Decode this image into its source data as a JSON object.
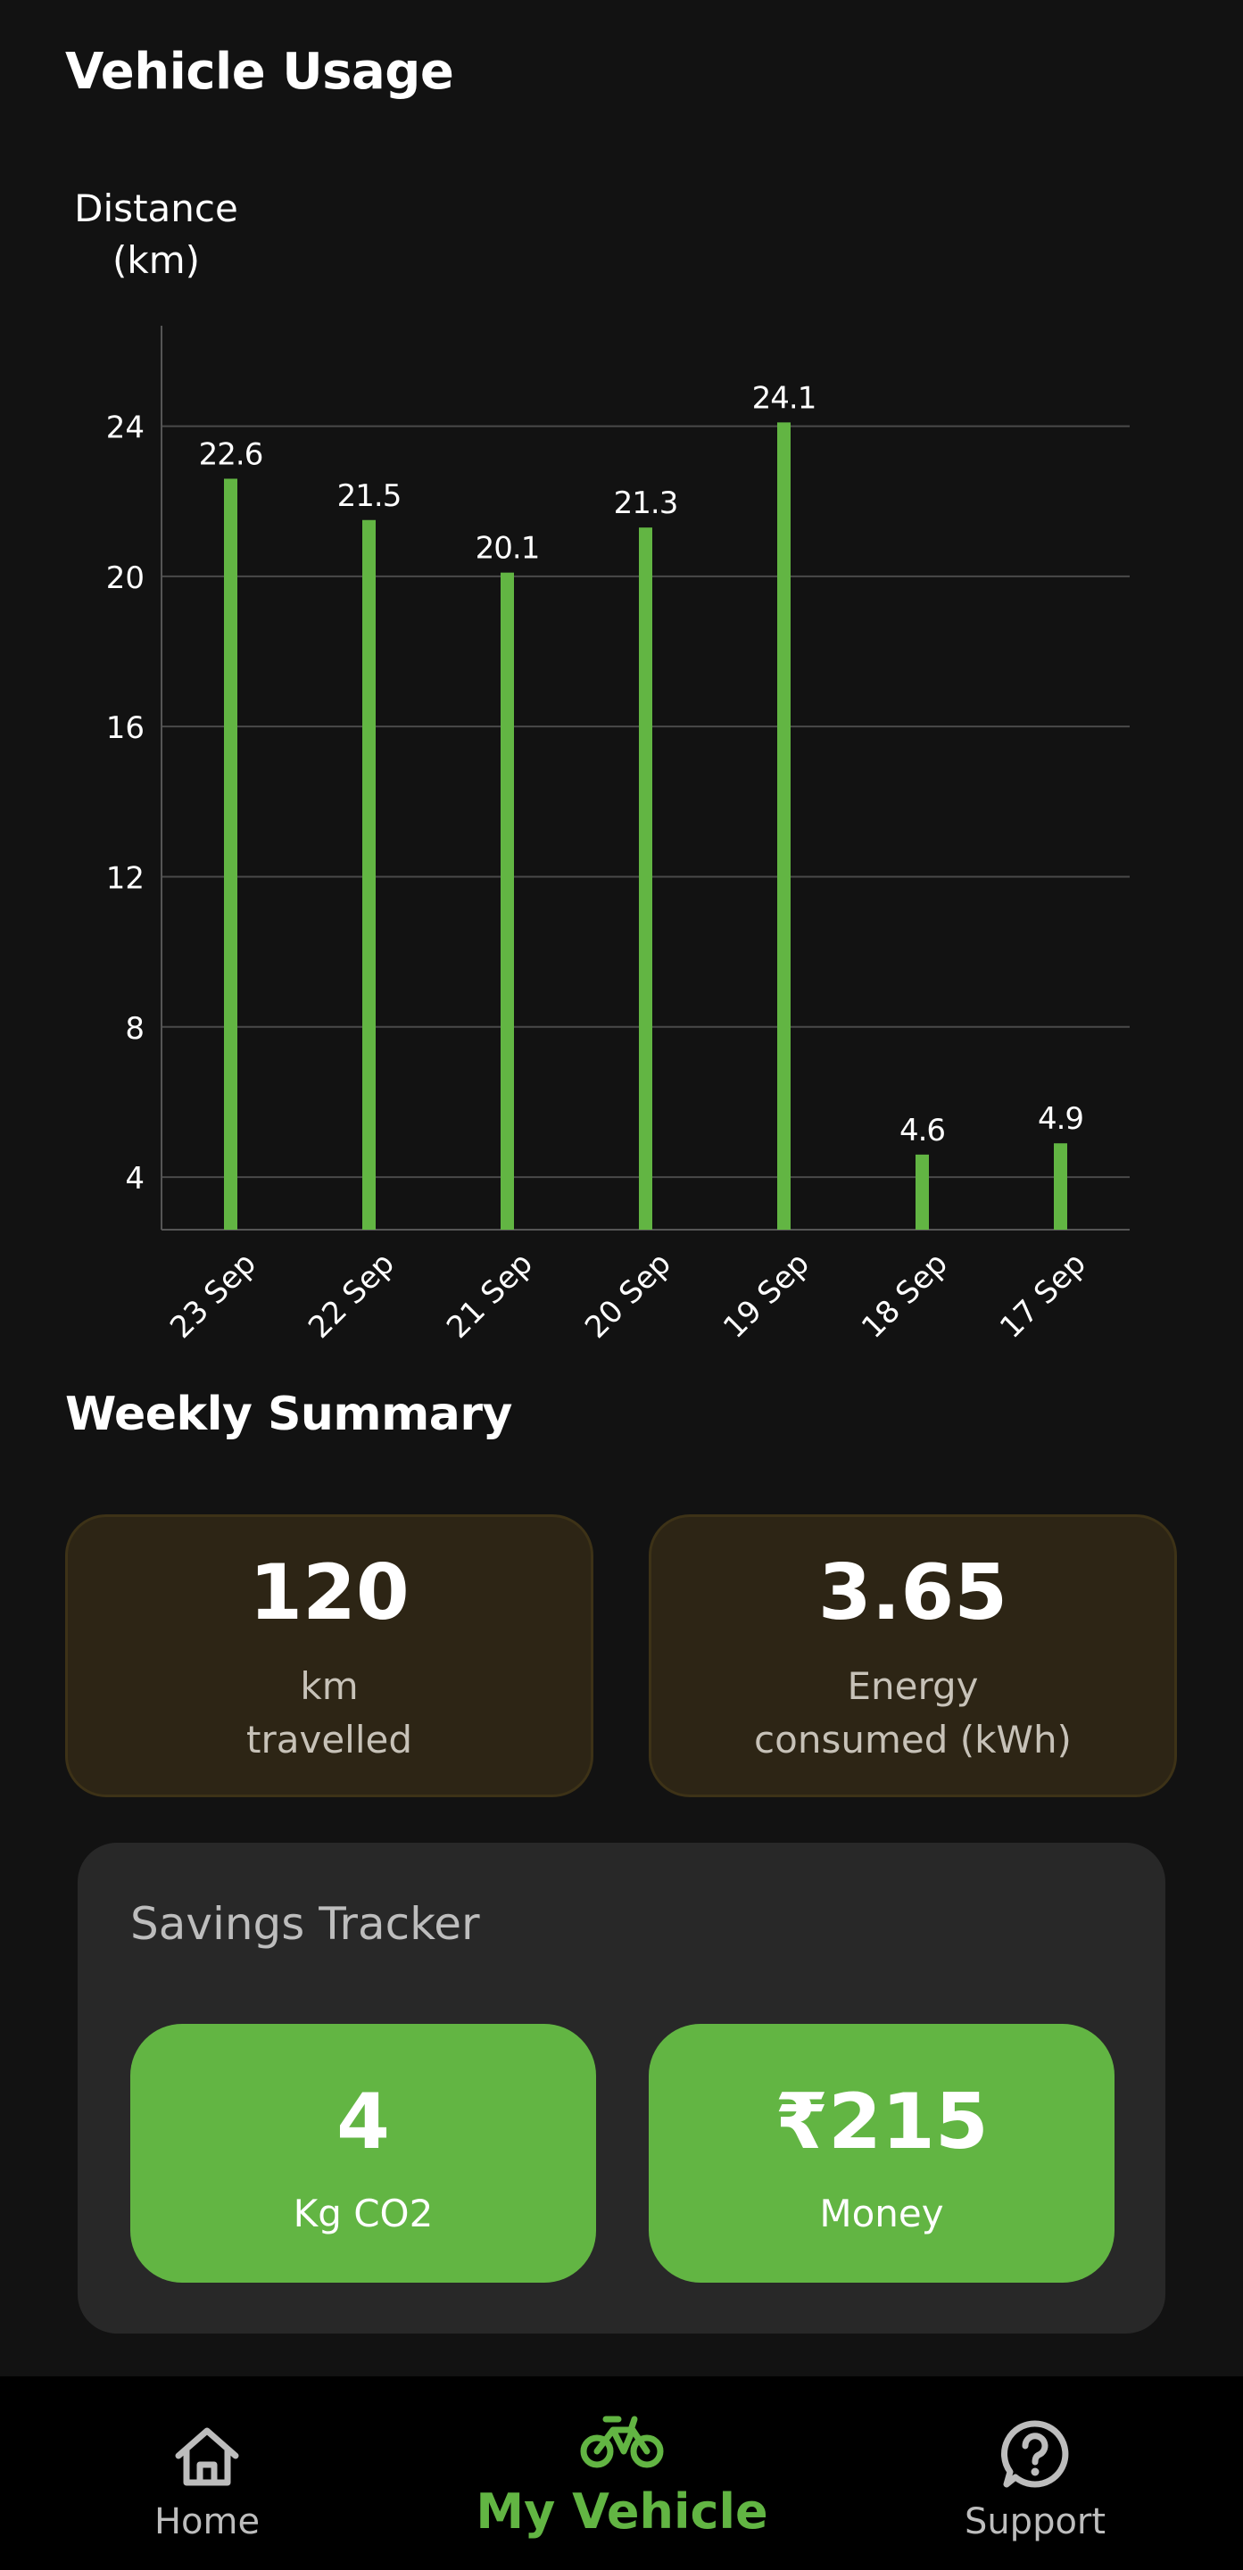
{
  "page": {
    "title": "Vehicle Usage"
  },
  "chart_data": {
    "type": "bar",
    "ylabel": "Distance\n(km)",
    "ylabel_lines": [
      "Distance",
      "(km)"
    ],
    "categories": [
      "23 Sep",
      "22 Sep",
      "21 Sep",
      "20 Sep",
      "19 Sep",
      "18 Sep",
      "17 Sep"
    ],
    "values": [
      22.6,
      21.5,
      20.1,
      21.3,
      24.1,
      4.6,
      4.9
    ],
    "value_labels": [
      "22.6",
      "21.5",
      "20.1",
      "21.3",
      "24.1",
      "4.6",
      "4.9"
    ],
    "yticks": [
      4,
      8,
      12,
      16,
      20,
      24
    ],
    "ylim": [
      2.6,
      26.2
    ],
    "grid": true,
    "bar_color": "#62b543"
  },
  "weekly_summary": {
    "title": "Weekly Summary",
    "distance": {
      "value": "120",
      "label_line1": "km",
      "label_line2": "travelled"
    },
    "energy": {
      "value": "3.65",
      "label_line1": "Energy",
      "label_line2": "consumed (kWh)"
    }
  },
  "savings": {
    "title": "Savings Tracker",
    "co2": {
      "value": "4",
      "label": "Kg CO2"
    },
    "money": {
      "value": "₹215",
      "label": "Money"
    }
  },
  "nav": {
    "home": {
      "label": "Home",
      "icon": "home-icon"
    },
    "vehicle": {
      "label": "My Vehicle",
      "icon": "bicycle-icon"
    },
    "support": {
      "label": "Support",
      "icon": "help-icon"
    }
  },
  "colors": {
    "background": "#121212",
    "accent": "#62b543",
    "summary_card": "#2d2515",
    "savings_panel": "#282828",
    "navbar": "#000000"
  }
}
